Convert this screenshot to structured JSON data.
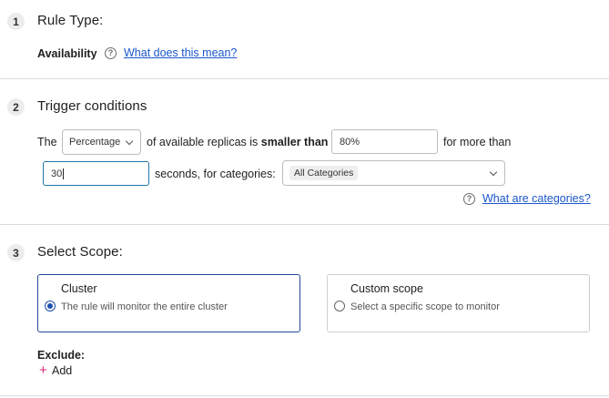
{
  "rule_type": {
    "step": "1",
    "title": "Rule Type:",
    "value": "Availability",
    "help_link": "What does this mean?"
  },
  "trigger": {
    "step": "2",
    "title": "Trigger conditions",
    "the_label": "The",
    "metric_select": "Percentage",
    "of_label": "of available replicas is",
    "comparison": "smaller than",
    "threshold_value": "80%",
    "for_more_than": "for more than",
    "duration_value": "30",
    "seconds_label": "seconds, for categories:",
    "categories_chip": "All Categories",
    "categories_help_link": "What are categories?"
  },
  "scope": {
    "step": "3",
    "title": "Select Scope:",
    "options": [
      {
        "title": "Cluster",
        "desc": "The rule will monitor the entire cluster",
        "selected": true
      },
      {
        "title": "Custom scope",
        "desc": "Select a specific scope to monitor",
        "selected": false
      }
    ],
    "exclude_label": "Exclude:",
    "add_label": "Add"
  },
  "colors": {
    "link": "#1a56c9",
    "selected_border": "#234b9b",
    "radio_accent": "#1d4fb0",
    "add_plus": "#d6247a",
    "focus_border": "#1f78a8"
  }
}
